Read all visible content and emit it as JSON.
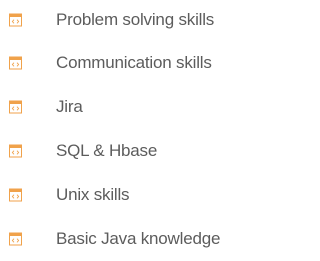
{
  "skills": {
    "icon": "code-file-icon",
    "icon_color": "#f0a24b",
    "text_color": "#5c5c5c",
    "items": [
      {
        "label": "Problem solving skills"
      },
      {
        "label": "Communication skills"
      },
      {
        "label": "Jira"
      },
      {
        "label": "SQL & Hbase"
      },
      {
        "label": "Unix skills"
      },
      {
        "label": "Basic Java knowledge"
      }
    ]
  }
}
